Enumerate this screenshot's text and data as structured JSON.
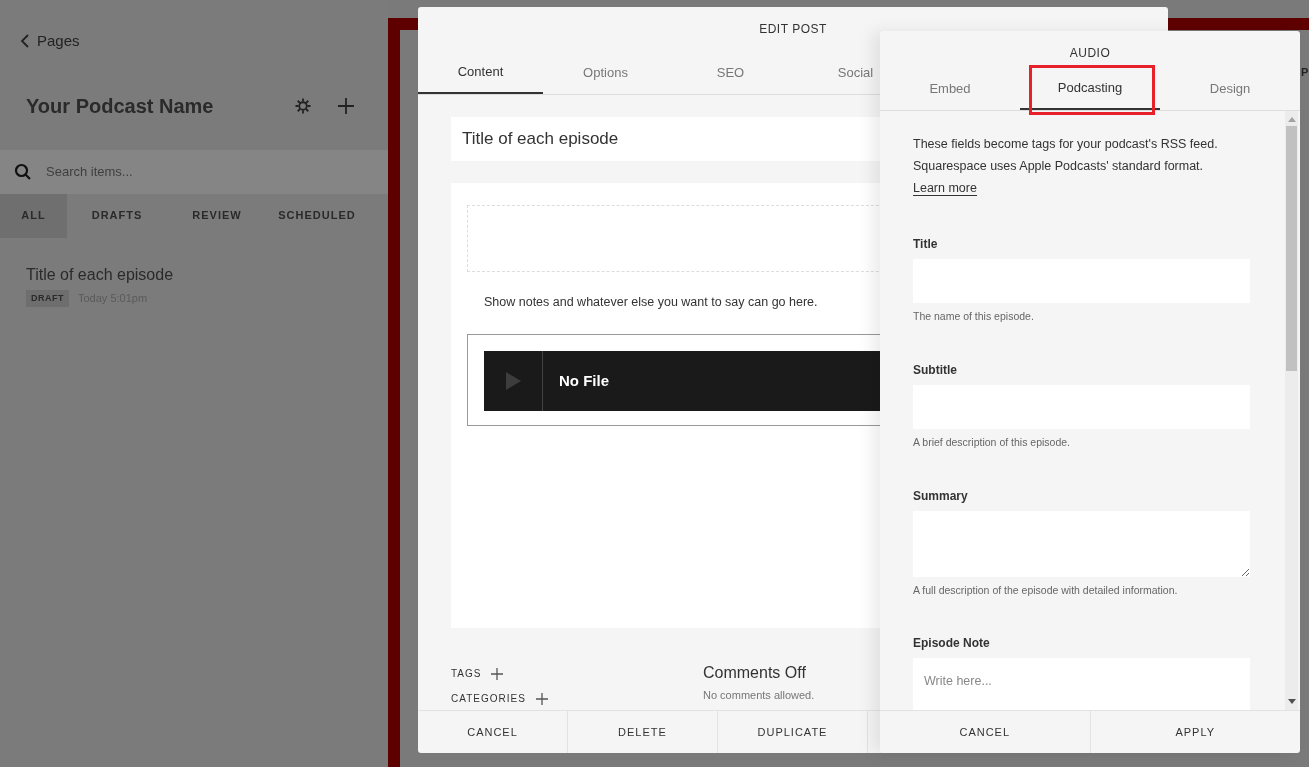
{
  "sidebar": {
    "back_link": "Pages",
    "title": "Your Podcast Name",
    "search": {
      "placeholder": "Search items..."
    },
    "filters": [
      {
        "label": "ALL",
        "selected": true
      },
      {
        "label": "DRAFTS",
        "selected": false
      },
      {
        "label": "REVIEW",
        "selected": false
      },
      {
        "label": "SCHEDULED",
        "selected": false
      }
    ],
    "posts": [
      {
        "title": "Title of each episode",
        "status": "DRAFT",
        "time": "Today 5:01pm"
      }
    ]
  },
  "background": {
    "text_fragment": "P"
  },
  "edit_post": {
    "title": "EDIT POST",
    "tabs": [
      {
        "label": "Content",
        "selected": true
      },
      {
        "label": "Options",
        "selected": false
      },
      {
        "label": "SEO",
        "selected": false
      },
      {
        "label": "Social",
        "selected": false
      }
    ],
    "post_title": "Title of each episode",
    "body_text": "Show notes and whatever else you want to say can go here.",
    "audio_block": {
      "label": "No File"
    },
    "tags_label": "TAGS",
    "categories_label": "CATEGORIES",
    "comments": {
      "title": "Comments Off",
      "note": "No comments allowed."
    },
    "buttons": [
      "CANCEL",
      "DELETE",
      "DUPLICATE"
    ]
  },
  "audio_panel": {
    "title": "AUDIO",
    "tabs": [
      {
        "label": "Embed",
        "selected": false
      },
      {
        "label": "Podcasting",
        "selected": true,
        "highlighted": true
      },
      {
        "label": "Design",
        "selected": false
      }
    ],
    "intro": "These fields become tags for your podcast's RSS feed. Squarespace uses Apple Podcasts' standard format.",
    "link": "Learn more",
    "fields": [
      {
        "kind": "input",
        "label": "Title",
        "help": "The name of this episode."
      },
      {
        "kind": "input",
        "label": "Subtitle",
        "help": "A brief description of this episode."
      },
      {
        "kind": "textarea",
        "label": "Summary",
        "help": "A full description of the episode with detailed information."
      },
      {
        "kind": "textarea",
        "label": "Episode Note",
        "placeholder": "Write here..."
      }
    ],
    "buttons": [
      "CANCEL",
      "APPLY"
    ]
  }
}
